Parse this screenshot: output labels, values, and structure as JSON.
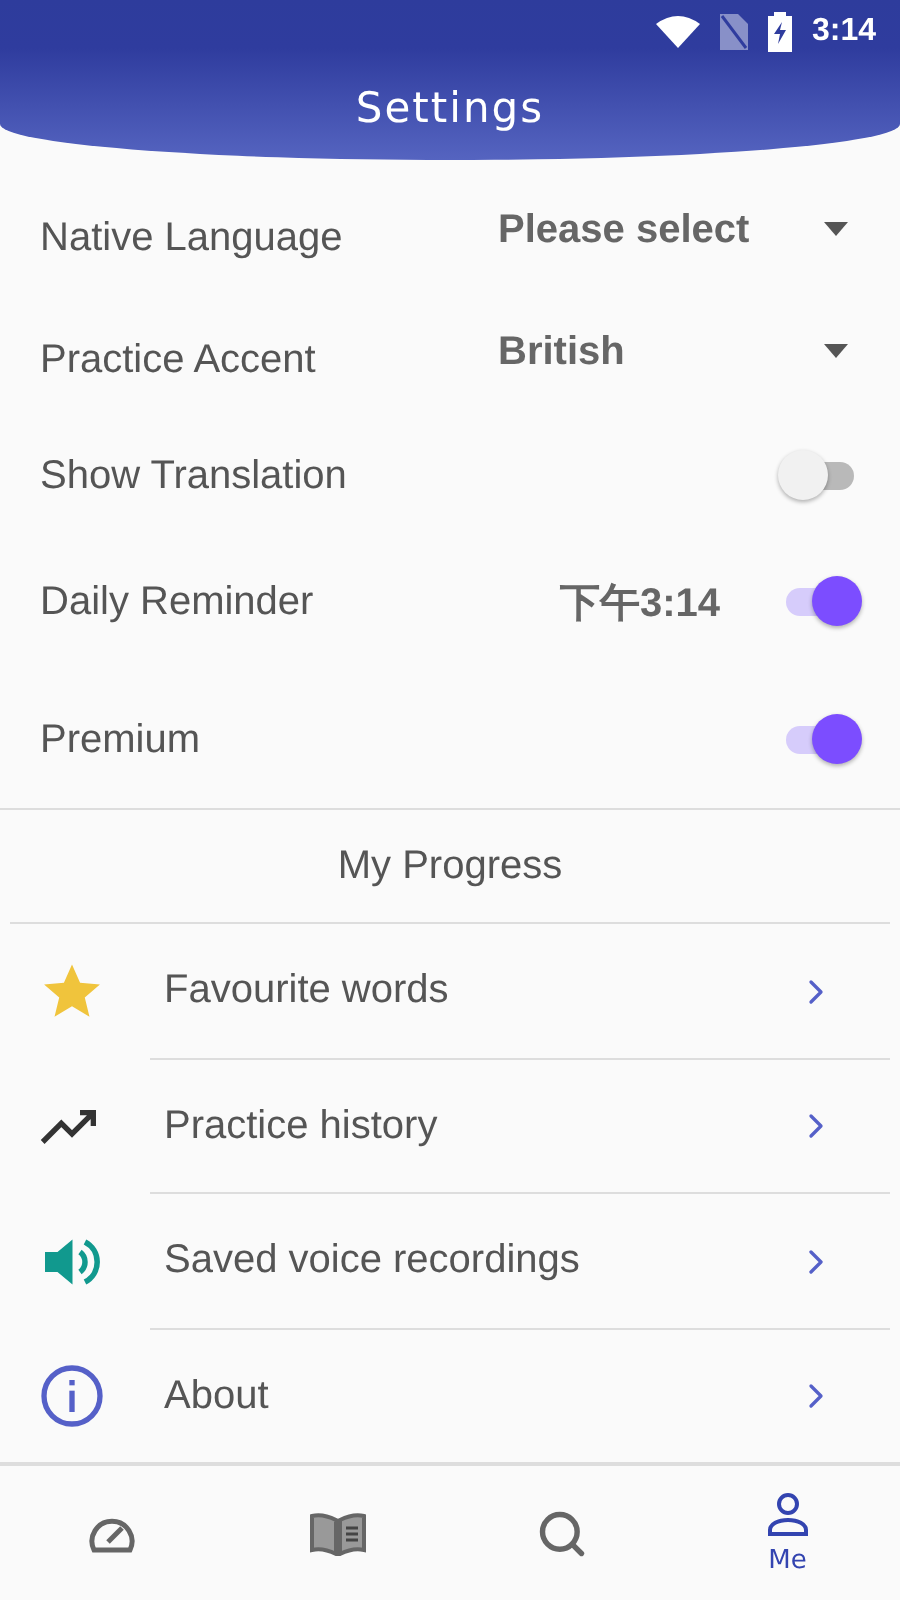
{
  "status_bar": {
    "time": "3:14"
  },
  "header": {
    "title": "Settings"
  },
  "settings": [
    {
      "kind": "select",
      "label": "Native Language",
      "value": "Please select"
    },
    {
      "kind": "select",
      "label": "Practice Accent",
      "value": "British"
    },
    {
      "kind": "toggle",
      "label": "Show Translation",
      "on": false
    },
    {
      "kind": "toggle",
      "label": "Daily Reminder",
      "value": "下午3:14",
      "on": true
    },
    {
      "kind": "toggle",
      "label": "Premium",
      "on": true
    }
  ],
  "progress": {
    "title": "My Progress",
    "items": [
      {
        "label": "Favourite words"
      },
      {
        "label": "Practice history"
      },
      {
        "label": "Saved voice recordings"
      },
      {
        "label": "About"
      }
    ]
  },
  "bottom_nav": [
    {
      "selected": false
    },
    {
      "selected": false
    },
    {
      "selected": false
    },
    {
      "label": "Me",
      "selected": true
    }
  ]
}
